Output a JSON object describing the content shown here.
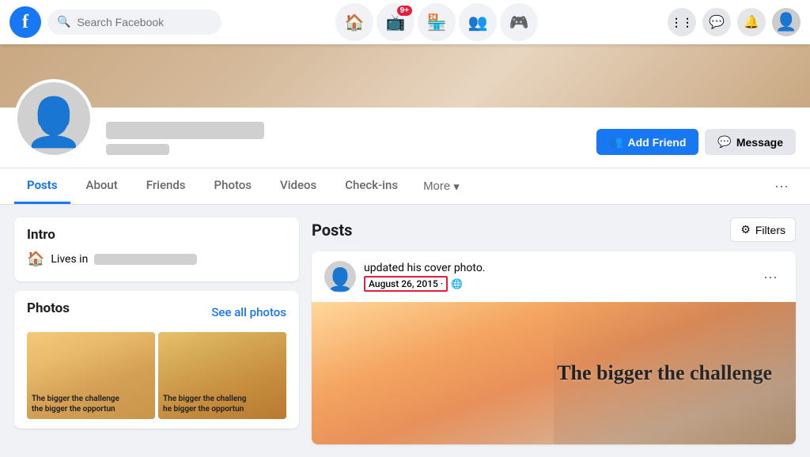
{
  "topnav": {
    "search_placeholder": "Search Facebook",
    "badge_count": "9+",
    "icons": {
      "home": "🏠",
      "watch": "📺",
      "marketplace": "🏪",
      "groups": "👥",
      "gaming": "🎮",
      "grid": "⋮⋮⋮",
      "messenger": "💬",
      "bell": "🔔"
    }
  },
  "profile": {
    "name_blurred": true,
    "sub_blurred": true,
    "add_friend_label": "Add Friend",
    "message_label": "Message"
  },
  "tabs": {
    "items": [
      {
        "id": "posts",
        "label": "Posts",
        "active": true
      },
      {
        "id": "about",
        "label": "About",
        "active": false
      },
      {
        "id": "friends",
        "label": "Friends",
        "active": false
      },
      {
        "id": "photos",
        "label": "Photos",
        "active": false
      },
      {
        "id": "videos",
        "label": "Videos",
        "active": false
      },
      {
        "id": "checkins",
        "label": "Check-ins",
        "active": false
      }
    ],
    "more_label": "More",
    "ellipsis": "···"
  },
  "intro": {
    "title": "Intro",
    "lives_label": "Lives in"
  },
  "photos_section": {
    "title": "Photos",
    "see_all_label": "See all photos",
    "photo_text": "The bigger the challenge the bigger the opportun"
  },
  "posts_section": {
    "title": "Posts",
    "filters_label": "Filters",
    "post": {
      "action_text": "updated his cover photo.",
      "date": "August 26, 2015 ·",
      "image_text": "The bigger the challenge"
    }
  }
}
